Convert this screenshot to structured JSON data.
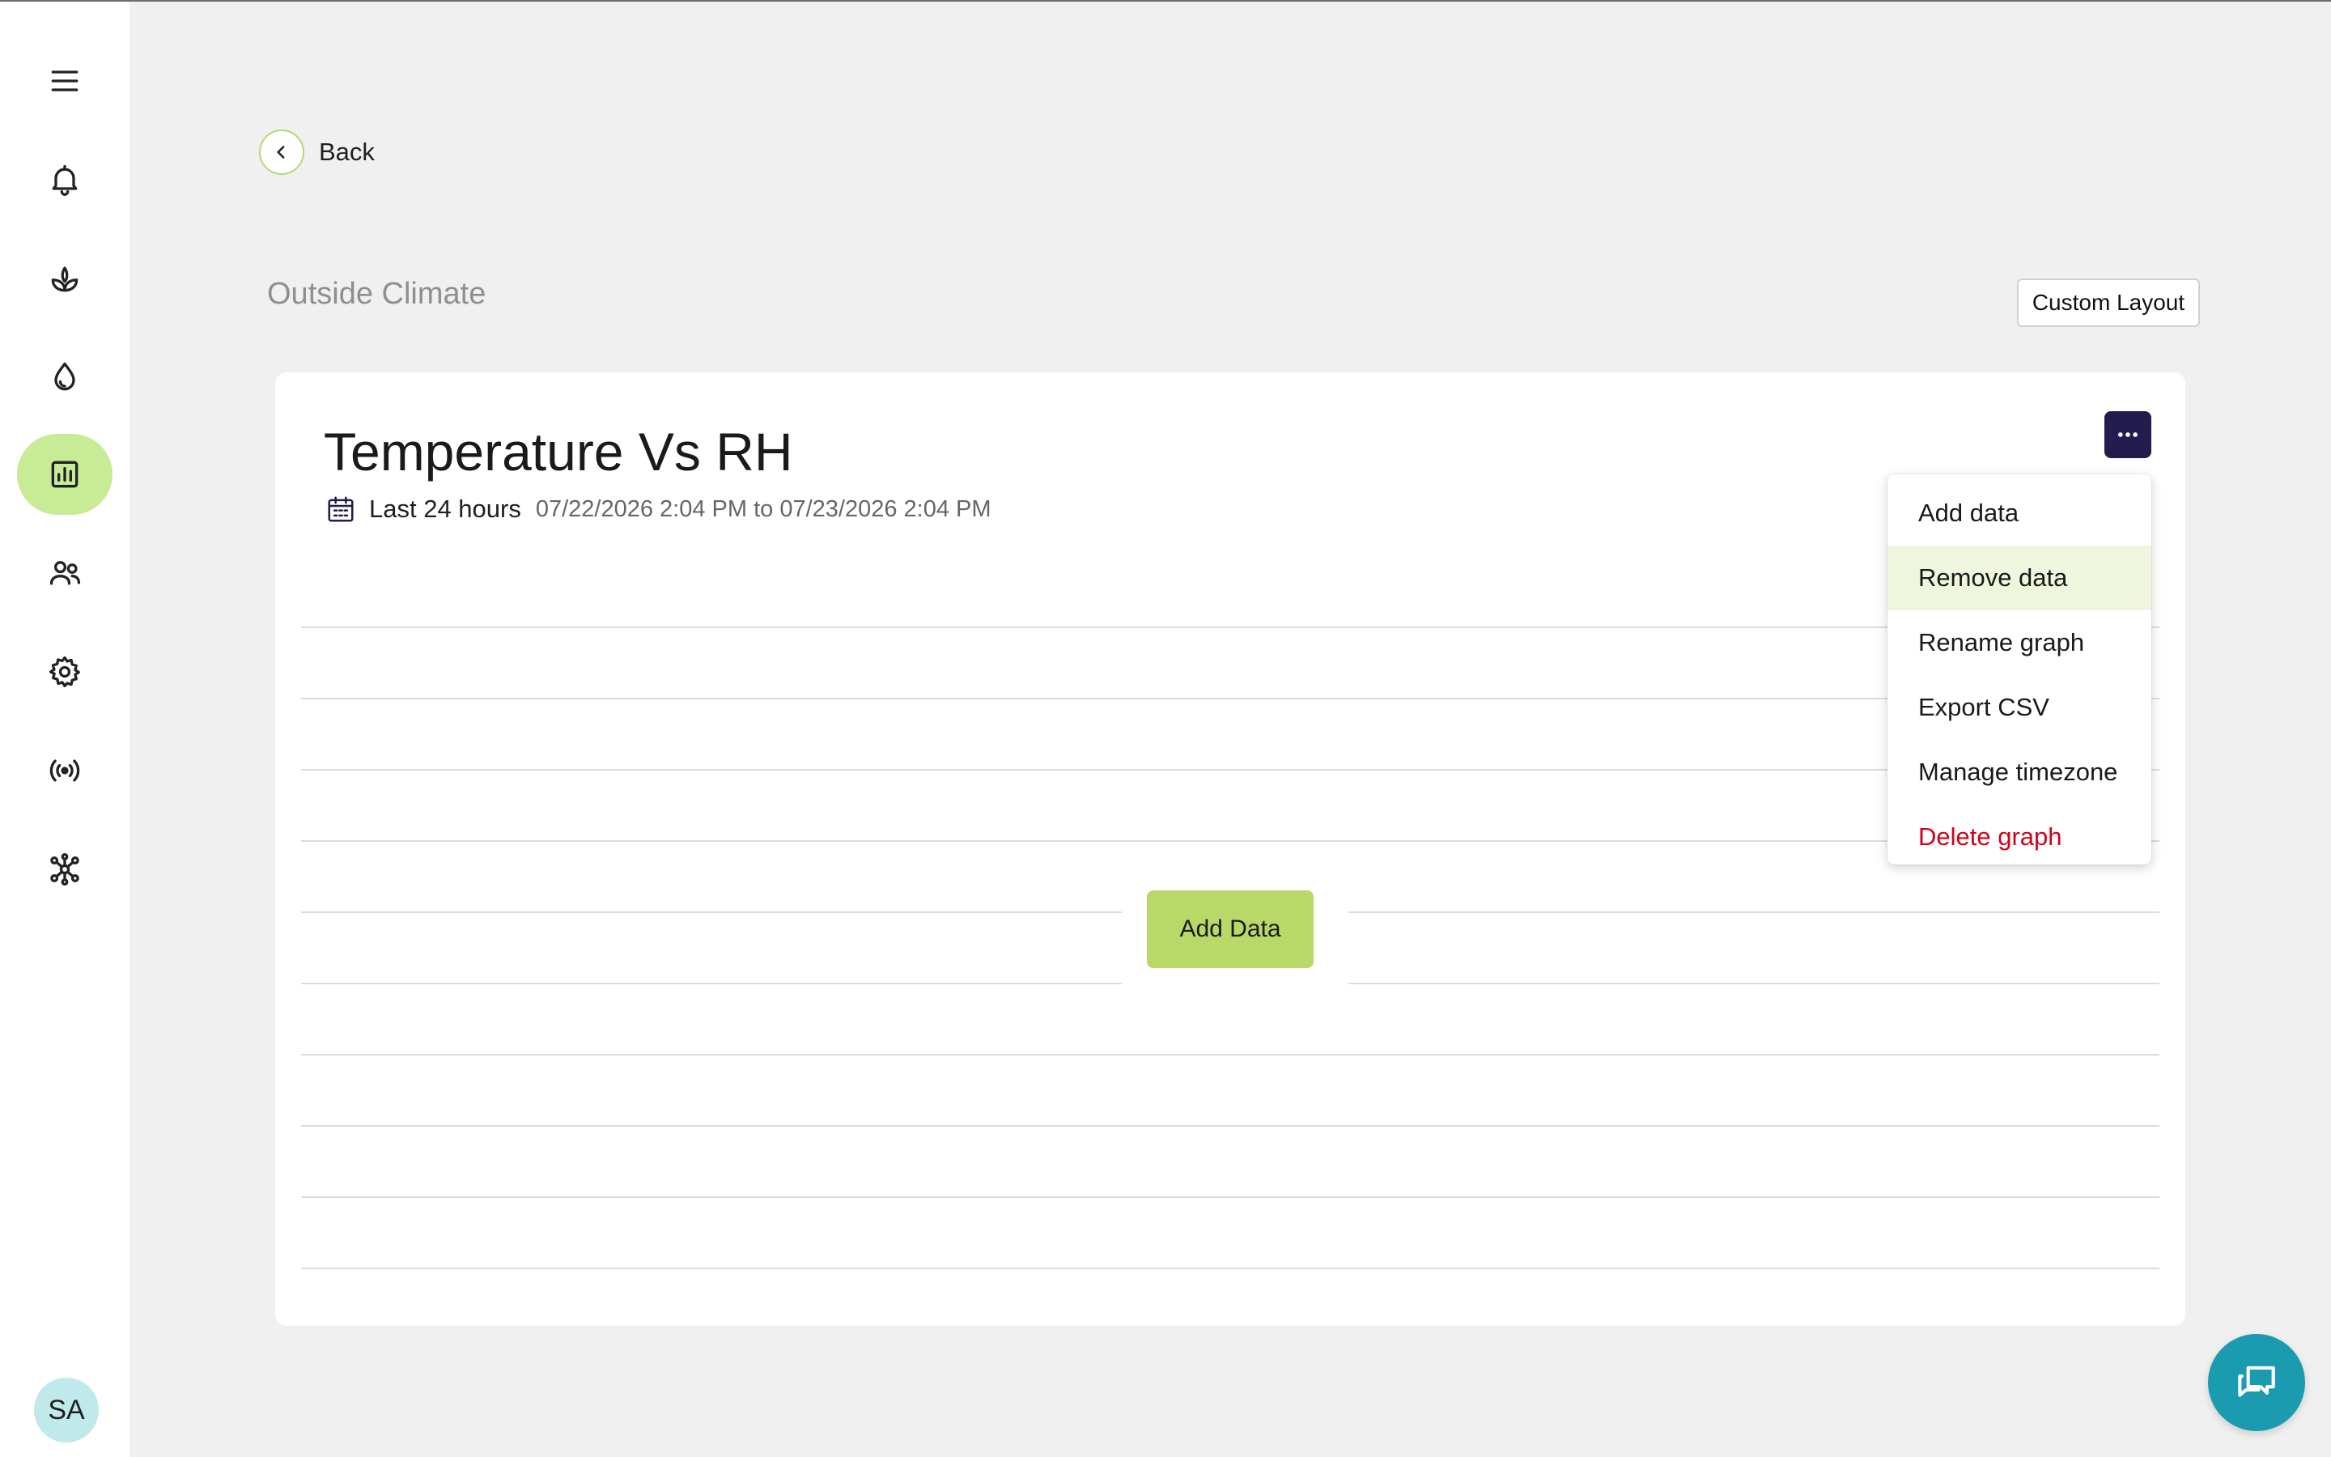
{
  "sidebar": {
    "items": [
      {
        "icon": "menu-icon"
      },
      {
        "icon": "bell-icon"
      },
      {
        "icon": "plant-icon"
      },
      {
        "icon": "water-drop-icon"
      },
      {
        "icon": "chart-icon",
        "active": true
      },
      {
        "icon": "users-icon"
      },
      {
        "icon": "gear-icon"
      },
      {
        "icon": "broadcast-icon"
      },
      {
        "icon": "network-icon"
      }
    ],
    "avatar_initials": "SA"
  },
  "header": {
    "back_label": "Back",
    "page_title": "Outside Climate",
    "custom_layout_label": "Custom Layout"
  },
  "graph": {
    "title": "Temperature Vs RH",
    "range_label": "Last 24 hours",
    "range_dates": "07/22/2026 2:04 PM to 07/23/2026 2:04 PM",
    "add_data_label": "Add Data"
  },
  "menu": {
    "items": [
      {
        "label": "Add data"
      },
      {
        "label": "Remove data",
        "highlighted": true
      },
      {
        "label": "Rename graph"
      },
      {
        "label": "Export CSV"
      },
      {
        "label": "Manage timezone"
      },
      {
        "label": "Delete graph",
        "danger": true
      }
    ]
  },
  "colors": {
    "accent": "#b8d968",
    "active_nav": "#c8eb95",
    "menu_button": "#221c4f",
    "danger": "#d0021b",
    "chat": "#1a9bb0"
  }
}
